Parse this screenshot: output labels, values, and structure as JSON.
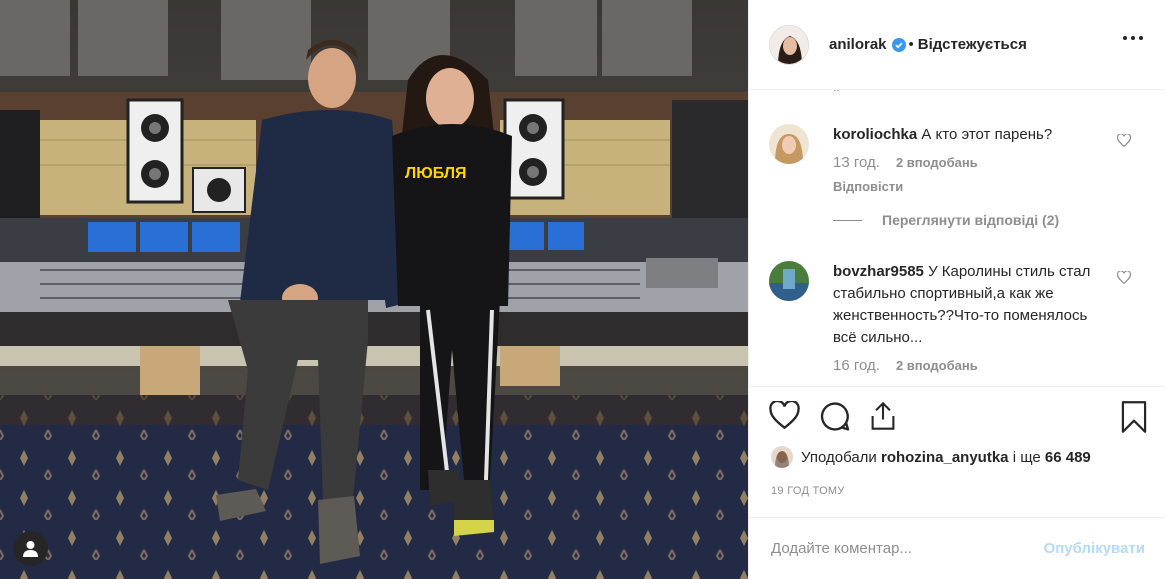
{
  "header": {
    "username": "anilorak",
    "follow_status": "Відстежується",
    "separator": "•",
    "icons": {
      "verified": "verified-badge-icon",
      "more": "more-options-icon"
    },
    "verified_color": "#3897f0"
  },
  "comments": {
    "clipped_text": "..",
    "items": [
      {
        "username": "koroliochka",
        "text": "А кто этот парень?",
        "time": "13 год.",
        "likes": "2 вподобань",
        "reply": "Відповісти",
        "view_replies": "Переглянути відповіді (2)"
      },
      {
        "username": "bovzhar9585",
        "text": "У Каролины стиль стал стабильно спортивный,а как же женственность??Что-то поменялось всё сильно...",
        "time": "16 год.",
        "likes": "2 вподобань"
      }
    ]
  },
  "actions": {
    "icons": [
      "heart-icon",
      "comment-icon",
      "share-icon",
      "bookmark-icon"
    ]
  },
  "likes": {
    "prefix": "Уподобали",
    "user": "rohozina_anyutka",
    "conjunction": "і ще",
    "count": "66 489"
  },
  "timestamp": "19 ГОД ТОМУ",
  "add_comment": {
    "placeholder": "Додайте коментар...",
    "publish": "Опублікувати",
    "publish_color": "#b3dbff"
  },
  "photo": {
    "tag_icon": "user-tag-icon"
  }
}
